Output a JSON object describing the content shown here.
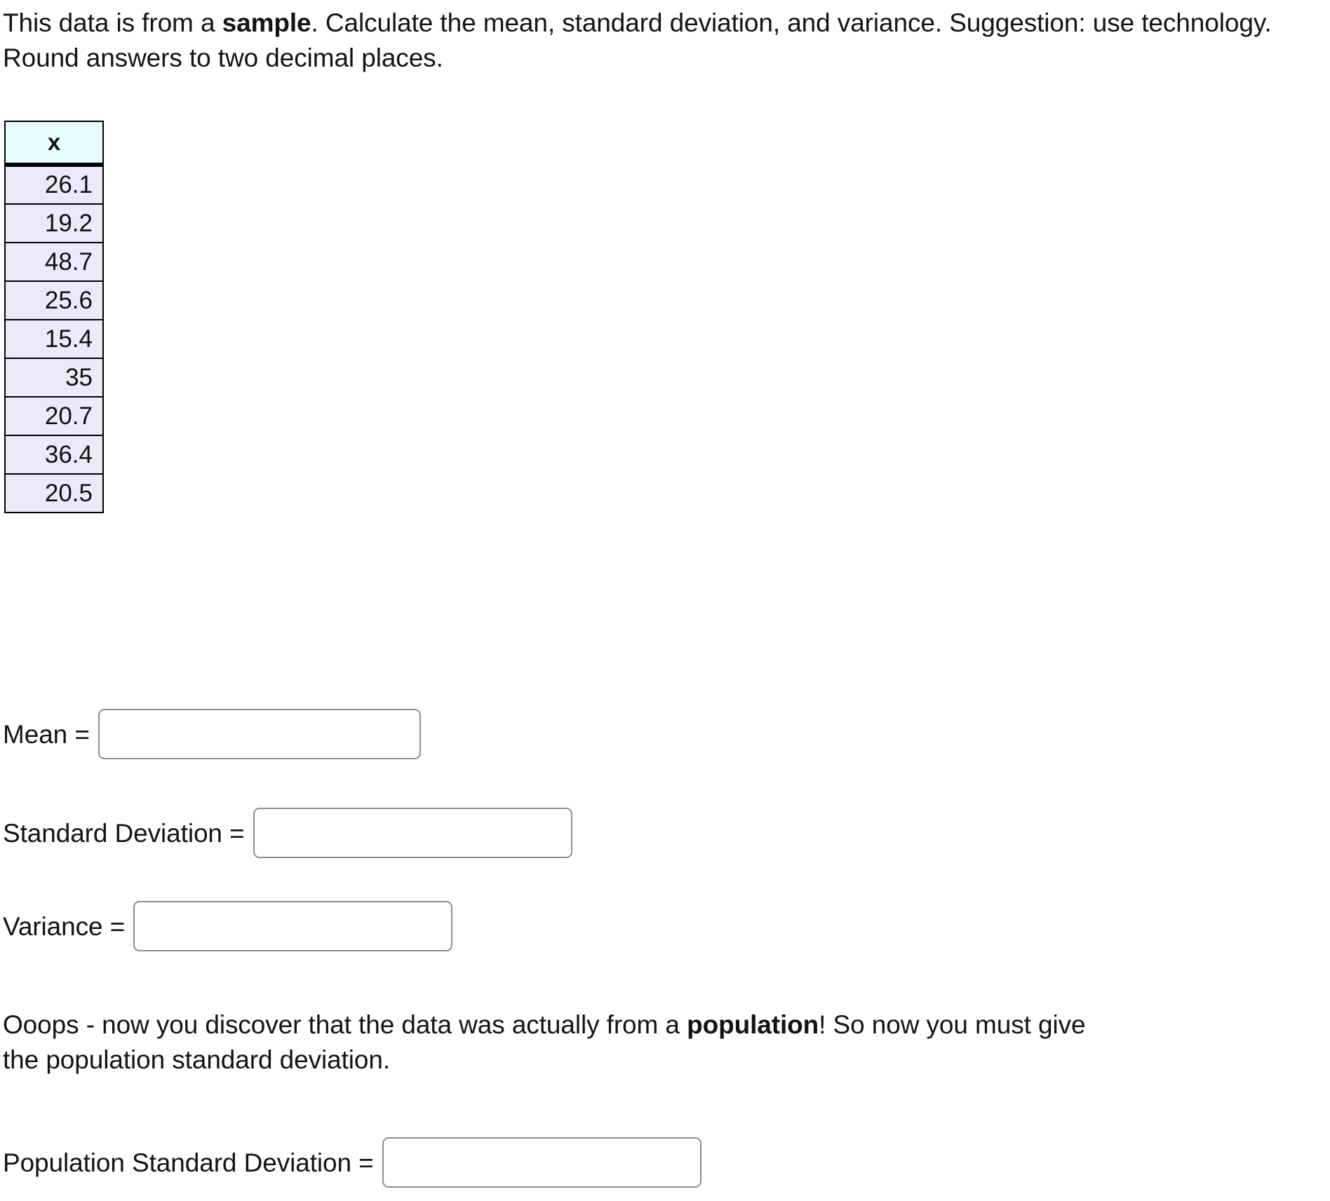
{
  "intro": {
    "before_bold": "This data is from a ",
    "bold": "sample",
    "after_bold": ". Calculate the mean, standard deviation, and variance. Suggestion: use technology. Round answers to two decimal places."
  },
  "table": {
    "column_header": "x",
    "values": [
      "26.1",
      "19.2",
      "48.7",
      "25.6",
      "15.4",
      "35",
      "20.7",
      "36.4",
      "20.5"
    ],
    "header_background": "#e7feff",
    "cell_background": "#eaeafb",
    "border_color": "#000000"
  },
  "answers": {
    "mean": {
      "label": "Mean =",
      "value": "",
      "placeholder": ""
    },
    "standard_deviation": {
      "label": "Standard Deviation =",
      "value": "",
      "placeholder": ""
    },
    "variance": {
      "label": "Variance =",
      "value": "",
      "placeholder": ""
    },
    "population_standard_deviation": {
      "label": "Population Standard Deviation =",
      "value": "",
      "placeholder": ""
    }
  },
  "oops": {
    "before_bold": "Ooops - now you discover that the data was actually from a ",
    "bold": "population",
    "after_bold": "! So now you must give the population standard deviation."
  },
  "chart_data": {
    "type": "table",
    "title": "",
    "categories": [
      "x"
    ],
    "values": [
      26.1,
      19.2,
      48.7,
      25.6,
      15.4,
      35,
      20.7,
      36.4,
      20.5
    ],
    "xlabel": "",
    "ylabel": "x"
  }
}
